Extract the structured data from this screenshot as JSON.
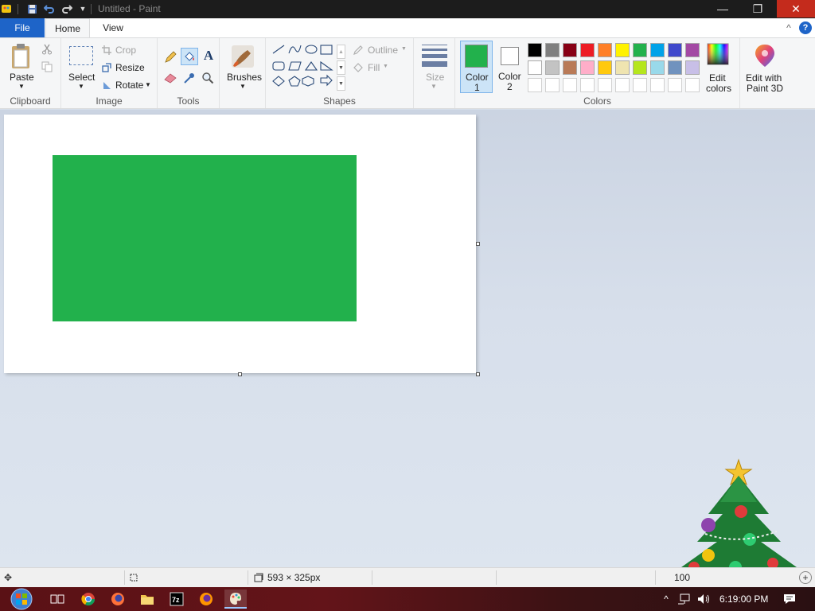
{
  "window": {
    "title": "Untitled - Paint",
    "minimize": "—",
    "restore": "❐",
    "close": "✕"
  },
  "tabs": {
    "file": "File",
    "home": "Home",
    "view": "View",
    "collapse": "^",
    "help": "?"
  },
  "ribbon": {
    "clipboard": {
      "group": "Clipboard",
      "paste": "Paste"
    },
    "image": {
      "group": "Image",
      "select": "Select",
      "crop": "Crop",
      "resize": "Resize",
      "rotate": "Rotate"
    },
    "tools": {
      "group": "Tools",
      "text_glyph": "A"
    },
    "brushes": {
      "label": "Brushes"
    },
    "shapes": {
      "group": "Shapes",
      "outline": "Outline",
      "fill": "Fill"
    },
    "size": {
      "label": "Size"
    },
    "colors": {
      "group": "Colors",
      "color1": "Color",
      "color1_num": "1",
      "color2": "Color",
      "color2_num": "2",
      "color1_value": "#22b14c",
      "color2_value": "#ffffff",
      "edit_colors_1": "Edit",
      "edit_colors_2": "colors",
      "paint3d_1": "Edit with",
      "paint3d_2": "Paint 3D",
      "palette_row1": [
        "#000000",
        "#7f7f7f",
        "#880015",
        "#ed1c24",
        "#ff7f27",
        "#fff200",
        "#22b14c",
        "#00a2e8",
        "#3f48cc",
        "#a349a4"
      ],
      "palette_row2": [
        "#ffffff",
        "#c3c3c3",
        "#b97a57",
        "#ffaec9",
        "#ffc90e",
        "#efe4b0",
        "#b5e61d",
        "#99d9ea",
        "#7092be",
        "#c8bfe7"
      ]
    }
  },
  "canvas": {
    "background": "#ffffff",
    "rectangle_color": "#22b14c"
  },
  "statusbar": {
    "size": "593 × 325px",
    "zoom": "100"
  },
  "taskbar": {
    "time": "6:19:00 PM"
  }
}
